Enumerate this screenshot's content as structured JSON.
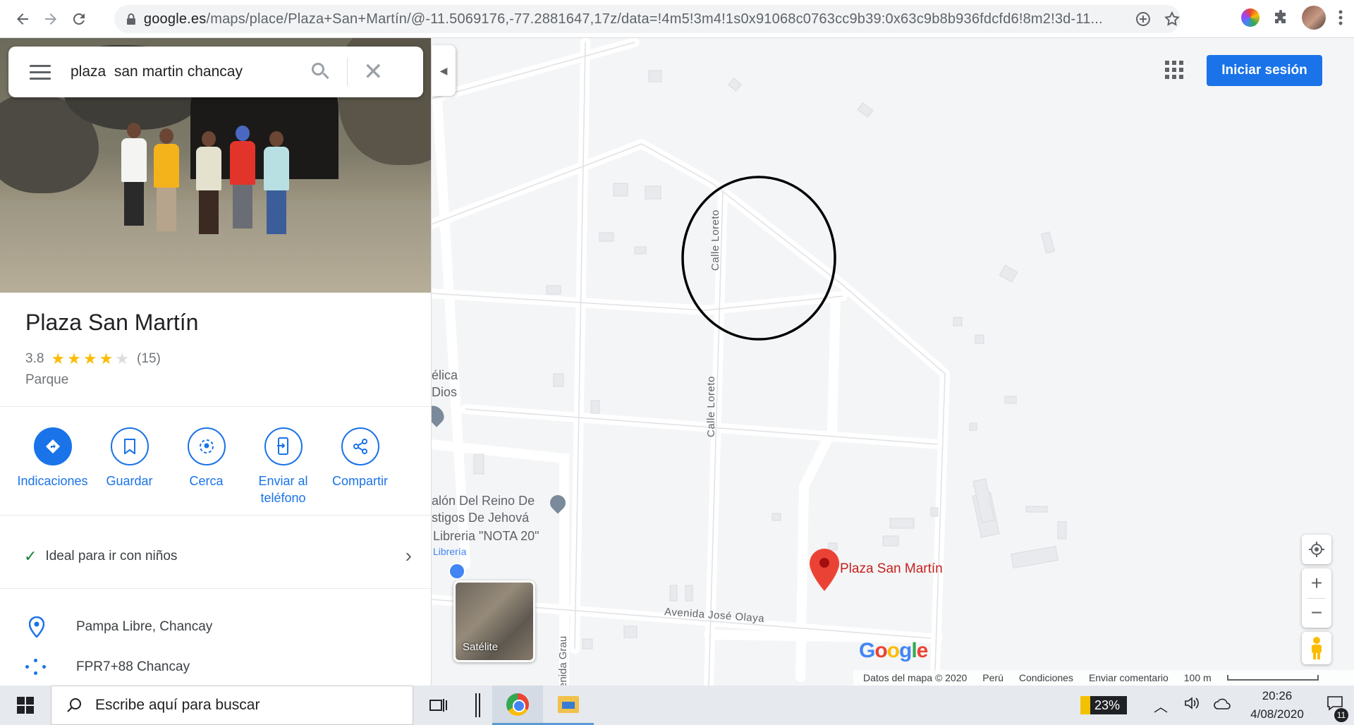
{
  "browser": {
    "url_host": "google.es",
    "url_rest": "/maps/place/Plaza+San+Martín/@-11.5069176,-77.2881647,17z/data=!4m5!3m4!1s0x91068c0763cc9b39:0x63c9b8b936fdcfd6!8m2!3d-11...",
    "back_icon": "arrow-left-icon",
    "forward_icon": "arrow-right-icon",
    "reload_icon": "reload-icon"
  },
  "search": {
    "value": "plaza  san martin chancay"
  },
  "place": {
    "name": "Plaza San Martín",
    "rating": "3.8",
    "stars_filled": 4,
    "reviews": "(15)",
    "category": "Parque"
  },
  "actions": [
    {
      "label": "Indicaciones",
      "icon": "directions-icon"
    },
    {
      "label": "Guardar",
      "icon": "bookmark-icon"
    },
    {
      "label": "Cerca",
      "icon": "nearby-icon"
    },
    {
      "label": "Enviar al teléfono",
      "icon": "send-to-phone-icon"
    },
    {
      "label": "Compartir",
      "icon": "share-icon"
    }
  ],
  "feature": {
    "label": "Ideal para ir con niños"
  },
  "info": {
    "address": "Pampa Libre, Chancay",
    "pluscode": "FPR7+88 Chancay"
  },
  "map": {
    "signin_label": "Iniciar sesión",
    "street_labels": [
      "Calle Loreto",
      "Calle Loreto",
      "Avenida José Olaya",
      "enida Grau"
    ],
    "poi_labels": [
      "élica",
      "Dios",
      "alón Del Reino De",
      "stigos De Jehová",
      "Libreria \"NOTA 20\"",
      "Librería"
    ],
    "marker_label": "Plaza San Martín",
    "satellite_label": "Satélite",
    "google_logo": "Google",
    "footer": {
      "data": "Datos del mapa © 2020",
      "country": "Perú",
      "terms": "Condiciones",
      "feedback": "Enviar comentario",
      "scale": "100 m"
    }
  },
  "taskbar": {
    "search_placeholder": "Escribe aquí para buscar",
    "battery": "23%",
    "time": "20:26",
    "date": "4/08/2020",
    "notifications": "11"
  },
  "colors": {
    "accent": "#1a73e8",
    "marker": "#ea4335",
    "star": "#fbbc04"
  }
}
